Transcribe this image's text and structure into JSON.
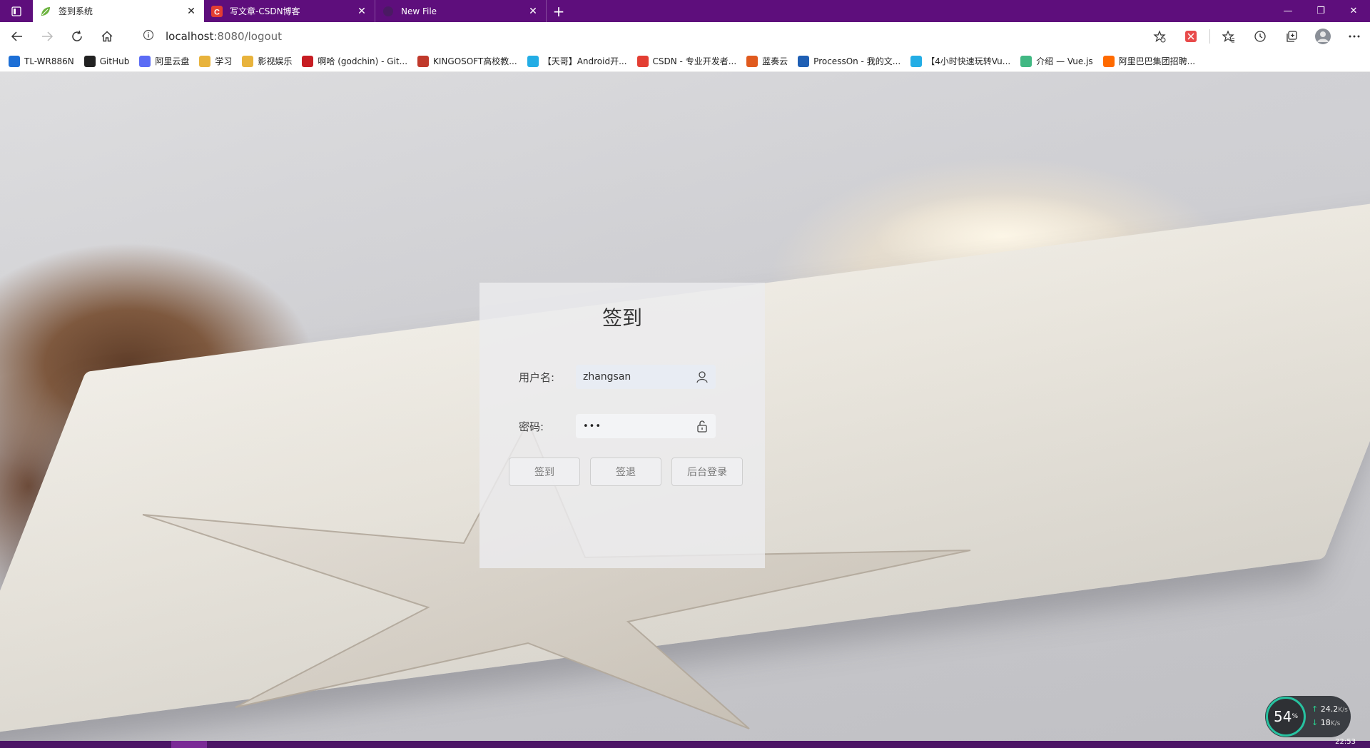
{
  "browser": {
    "tabs": [
      {
        "title": "签到系统",
        "active": true
      },
      {
        "title": "写文章-CSDN博客",
        "active": false
      },
      {
        "title": "New File",
        "active": false
      }
    ],
    "url": {
      "host": "localhost",
      "path": ":8080/logout"
    }
  },
  "bookmarks": [
    {
      "label": "TL-WR886N",
      "icon": "tp-link-icon",
      "color": "#1d6fd6"
    },
    {
      "label": "GitHub",
      "icon": "github-icon",
      "color": "#222222"
    },
    {
      "label": "阿里云盘",
      "icon": "aliyun-drive-icon",
      "color": "#5b6cf5"
    },
    {
      "label": "学习",
      "icon": "folder-icon",
      "color": "#e8b33c"
    },
    {
      "label": "影视娱乐",
      "icon": "folder-icon",
      "color": "#e8b33c"
    },
    {
      "label": "啊哈 (godchin) - Git...",
      "icon": "gitee-icon",
      "color": "#c71d23"
    },
    {
      "label": "KINGOSOFT高校教...",
      "icon": "kingosoft-icon",
      "color": "#c0392b"
    },
    {
      "label": "【天哥】Android开...",
      "icon": "bilibili-icon",
      "color": "#23ade5"
    },
    {
      "label": "CSDN - 专业开发者...",
      "icon": "csdn-icon",
      "color": "#e33e33"
    },
    {
      "label": "蓝奏云",
      "icon": "lanzou-icon",
      "color": "#e05a1e"
    },
    {
      "label": "ProcessOn - 我的文...",
      "icon": "processon-icon",
      "color": "#1f5fb4"
    },
    {
      "label": "【4小时快速玩转Vu...",
      "icon": "bilibili-icon",
      "color": "#23ade5"
    },
    {
      "label": "介绍 — Vue.js",
      "icon": "vue-icon",
      "color": "#41b883"
    },
    {
      "label": "阿里巴巴集团招聘...",
      "icon": "alibaba-icon",
      "color": "#ff6a00"
    }
  ],
  "login": {
    "title": "签到",
    "username_label": "用户名:",
    "username_value": "zhangsan",
    "password_label": "密码:",
    "password_value": "•••",
    "buttons": {
      "checkin": "签到",
      "checkout": "签退",
      "admin": "后台登录"
    }
  },
  "network": {
    "cpu": "54",
    "cpu_unit": "%",
    "up": "24.2",
    "up_unit": "K/s",
    "down": "18",
    "down_unit": "K/s"
  },
  "clock": "22:53"
}
